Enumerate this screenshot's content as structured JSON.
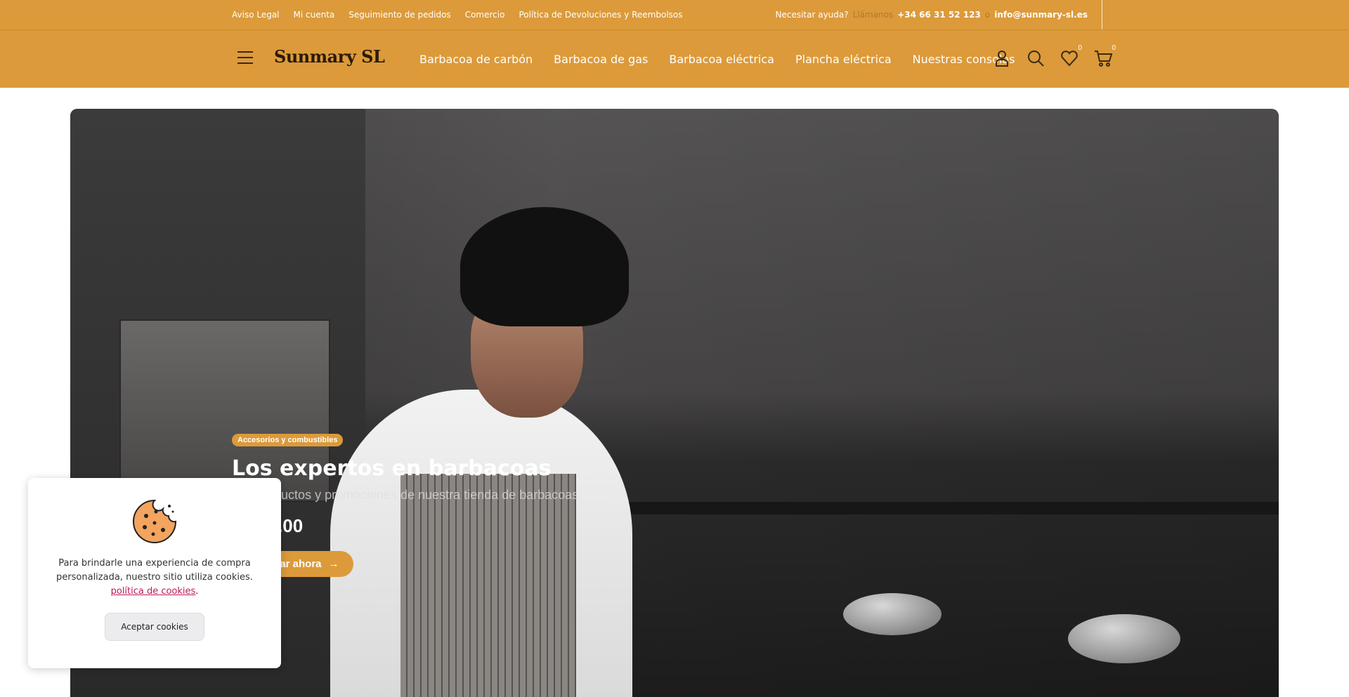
{
  "topbar": {
    "links": [
      "Aviso Legal",
      "Mi cuenta",
      "Seguimiento de pedidos",
      "Comercio",
      "Política de Devoluciones y Reembolsos"
    ],
    "help_label": "Necesitar ayuda?",
    "call_label": "Llámanos",
    "phone": "+34 66 31 52 123",
    "or_label": "o",
    "email": "info@sunmary-sl.es"
  },
  "header": {
    "logo": "Sunmary SL",
    "nav": [
      "Barbacoa de carbón",
      "Barbacoa de gas",
      "Barbacoa eléctrica",
      "Plancha eléctrica",
      "Nuestras consolas"
    ],
    "wishlist_count": "0",
    "cart_count": "0"
  },
  "hero": {
    "badge": "Accesorios y combustibles",
    "title": "Los expertos en barbacoas",
    "subtitle": "Los productos y promociones de nuestra tienda de barbacoas.",
    "price": "€ 109.00",
    "cta": "Comprar ahora"
  },
  "cookie": {
    "text": "Para brindarle una experiencia de compra personalizada, nuestro sitio utiliza cookies.",
    "policy_link": "política de cookies",
    "period": ".",
    "accept": "Aceptar cookies"
  },
  "colors": {
    "accent": "#dc9a3a",
    "link": "#c2185b"
  }
}
